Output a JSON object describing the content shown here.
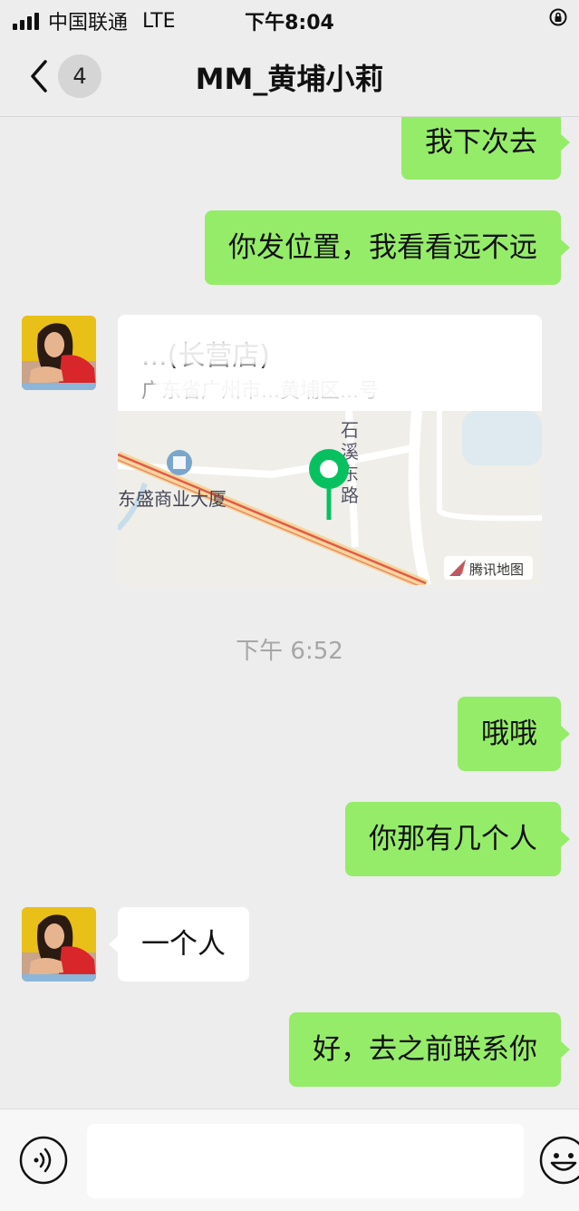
{
  "status_bar": {
    "carrier": "中国联通",
    "network": "LTE",
    "time": "下午8:04"
  },
  "nav": {
    "back_count": "4",
    "title": "MM_黄埔小莉"
  },
  "messages": {
    "m1": "我下次去",
    "m2": "你发位置，我看看远不远",
    "location": {
      "name": "...(长营店)",
      "address": "广东省广州市...黄埔区...号",
      "map_label_building": "东盛商业大厦",
      "map_label_road": "石溪东路",
      "map_brand": "腾讯地图"
    },
    "timestamp": "下午 6:52",
    "m3": "哦哦",
    "m4": "你那有几个人",
    "m5": "一个人",
    "m6": "好，去之前联系你"
  },
  "input": {
    "placeholder": ""
  },
  "colors": {
    "my_bubble": "#95ec69",
    "their_bubble": "#ffffff",
    "background": "#ededed",
    "map_pin": "#07c160"
  }
}
